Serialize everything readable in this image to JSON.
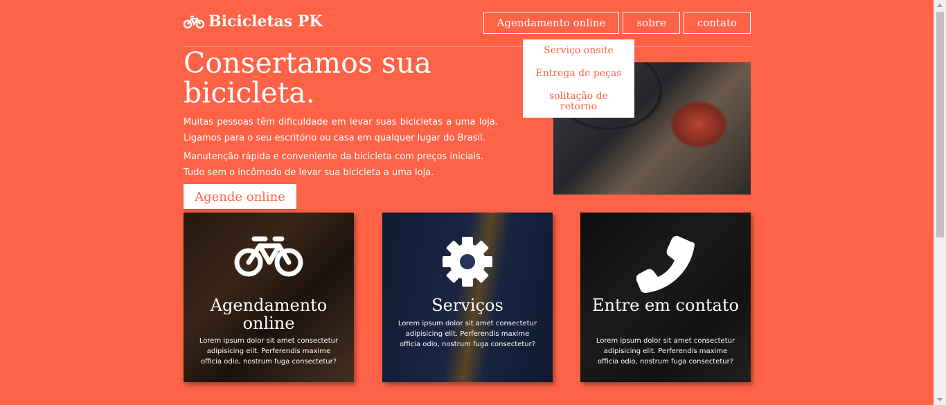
{
  "brand": {
    "name": "Bicicletas PK",
    "icon": "bicycle-icon"
  },
  "nav": {
    "items": [
      "Agendamento online",
      "sobre",
      "contato"
    ],
    "dropdown": [
      "Serviço onsite",
      "Entrega de peças",
      "solitação de retorno"
    ]
  },
  "hero": {
    "title": "Consertamos sua bicicleta.",
    "p1": "Muitas pessoas têm dificuldade em levar suas bicicletas a uma loja. Ligamos para o seu escritório ou casa em qualquer lugar do Brasil.",
    "p2": "Manutenção rápida e conveniente da bicicleta com preços iniciais. Tudo sem o incômodo de levar sua bicicleta a uma loja.",
    "cta": "Agende online"
  },
  "cards": [
    {
      "icon": "bicycle-icon",
      "title": "Agendamento online",
      "text": "Lorem ipsum dolor sit amet consectetur adipisicing elit. Perferendis maxime officia odio, nostrum fuga consectetur?"
    },
    {
      "icon": "gear-icon",
      "title": "Serviços",
      "text": "Lorem ipsum dolor sit amet consectetur adipisicing elit. Perferendis maxime officia odio, nostrum fuga consectetur?"
    },
    {
      "icon": "phone-icon",
      "title": "Entre em contato",
      "text": "Lorem ipsum dolor sit amet consectetur adipisicing elit. Perferendis maxime officia odio, nostrum fuga consectetur?"
    }
  ],
  "colors": {
    "accent": "#ff6347",
    "text": "#ffffff"
  }
}
